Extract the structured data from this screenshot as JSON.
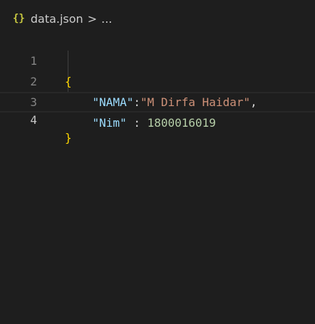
{
  "breadcrumb": {
    "icon": "{}",
    "file": "data.json",
    "separator": ">",
    "more": "..."
  },
  "lines": [
    {
      "number": "1",
      "open_brace": "{"
    },
    {
      "number": "2",
      "key": "\"NAMA\"",
      "colon": ":",
      "value": "\"M Dirfa Haidar\"",
      "trail": ","
    },
    {
      "number": "3",
      "key": "\"Nim\"",
      "colon": " : ",
      "value": "1800016019"
    },
    {
      "number": "4",
      "close_brace": "}"
    }
  ],
  "colors": {
    "background": "#1e1e1e",
    "key": "#9cdcfe",
    "string": "#ce9178",
    "number": "#b5cea8",
    "brace": "#ffd700"
  }
}
